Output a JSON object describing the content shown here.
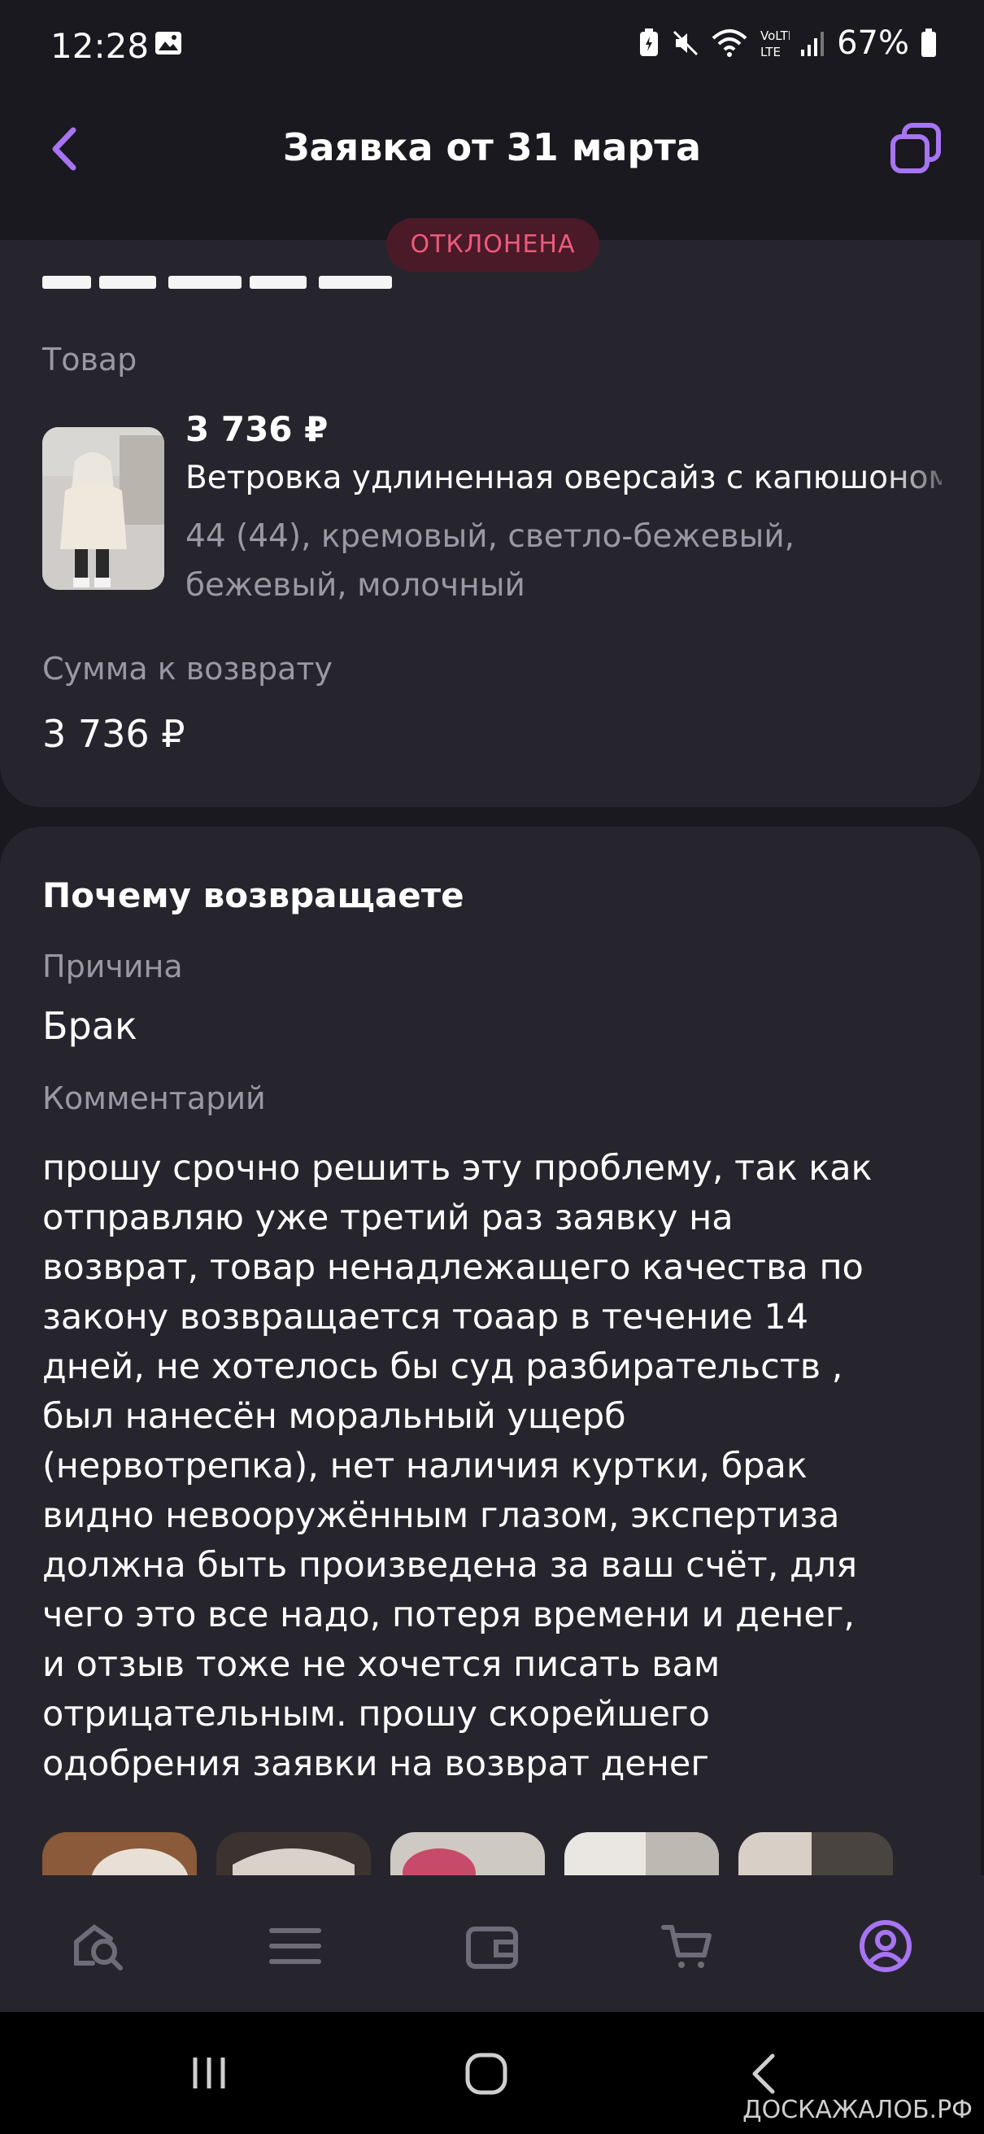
{
  "status_bar": {
    "time": "12:28",
    "battery": "67%",
    "network": "VoLTE"
  },
  "header": {
    "title": "Заявка от 31 марта"
  },
  "status_badge": "ОТКЛОНЕНА",
  "return_details": {
    "product_label": "Товар",
    "product": {
      "price": "3 736 ₽",
      "name": "Ветровка удлиненная оверсайз с капюшоном",
      "attributes": "44 (44), кремовый, светло-бежевый, бежевый, молочный"
    },
    "refund_label": "Сумма к возврату",
    "refund_value": "3 736 ₽"
  },
  "reason_section": {
    "title": "Почему возвращаете",
    "reason_label": "Причина",
    "reason_value": "Брак",
    "comment_label": "Комментарий",
    "comment_text": "прошу срочно решить эту проблему, так как\nотправляю уже третий раз заявку на\nвозврат,  товар ненадлежащего качества по\nзакону возвращается тоаар в течение 14\nдней, не хотелось бы суд разбирательств ,\nбыл нанесён моральный ущерб\n(нервотрепка), нет наличия куртки, брак\nвидно невооружённым глазом, экспертиза\nдолжна быть произведена за ваш счёт, для\nчего это все надо, потеря времени  и денег,\nи отзыв тоже не хочется писать вам\nотрицательным. прошу скорейшего\nодобрения заявки на возврат денег"
  },
  "bottom_nav": [
    "home-search-icon",
    "menu-icon",
    "wallet-icon",
    "cart-icon",
    "profile-icon"
  ],
  "watermark": "ДОСКАЖАЛОБ.РФ",
  "colors": {
    "background": "#1a191f",
    "card": "#26252d",
    "accent": "#a774f2",
    "badge_bg": "#4a1a29",
    "badge_text": "#f05a7a",
    "muted": "#9a98a3"
  }
}
